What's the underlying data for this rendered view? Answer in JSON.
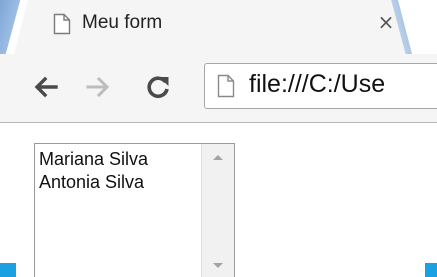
{
  "tab": {
    "title": "Meu form",
    "close_label": "×",
    "favicon": "page-icon"
  },
  "toolbar": {
    "back_icon": "back-arrow-icon",
    "forward_icon": "forward-arrow-icon",
    "reload_icon": "reload-icon",
    "url": "file:///C:/Use"
  },
  "listbox": {
    "options": [
      "Mariana Silva",
      "Antonia Silva"
    ]
  },
  "colors": {
    "accent": "#1ba1e2",
    "chrome_frame": "#8fb2dc"
  }
}
